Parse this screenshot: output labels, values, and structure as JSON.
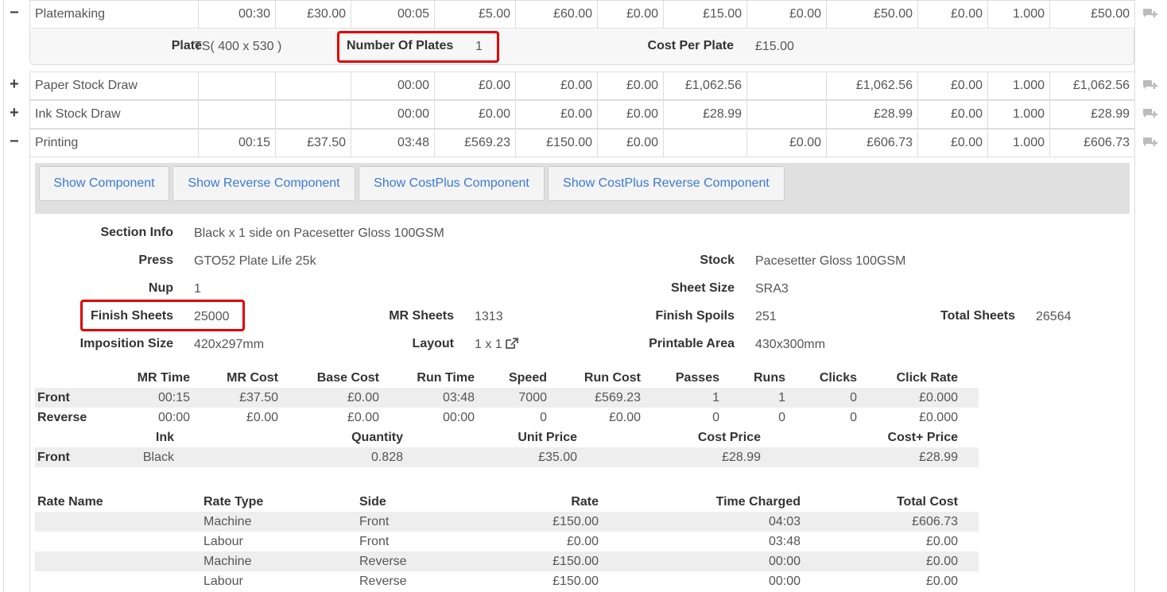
{
  "rows": [
    {
      "name": "Platemaking",
      "toggle": "−",
      "cols": [
        "00:30",
        "£30.00",
        "00:05",
        "£5.00",
        "£60.00",
        "£0.00",
        "£15.00",
        "£0.00",
        "£50.00",
        "£0.00",
        "1.000",
        "£50.00"
      ]
    },
    {
      "name": "Paper Stock Draw",
      "toggle": "+",
      "cols": [
        "",
        "",
        "00:00",
        "£0.00",
        "£0.00",
        "£0.00",
        "£1,062.56",
        "",
        "£1,062.56",
        "£0.00",
        "1.000",
        "£1,062.56"
      ]
    },
    {
      "name": "Ink Stock Draw",
      "toggle": "+",
      "cols": [
        "",
        "",
        "00:00",
        "£0.00",
        "£0.00",
        "£0.00",
        "£28.99",
        "",
        "£28.99",
        "£0.00",
        "1.000",
        "£28.99"
      ]
    },
    {
      "name": "Printing",
      "toggle": "−",
      "cols": [
        "00:15",
        "£37.50",
        "03:48",
        "£569.23",
        "£150.00",
        "£0.00",
        "",
        "£0.00",
        "£606.73",
        "£0.00",
        "1.000",
        "£606.73"
      ]
    }
  ],
  "plate_detail": {
    "plate_label": "Plate",
    "plate_value": "TS( 400 x 530 )",
    "num_plates_label": "Number Of Plates",
    "num_plates_value": "1",
    "cost_per_plate_label": "Cost Per Plate",
    "cost_per_plate_value": "£15.00"
  },
  "buttons": {
    "show_component": "Show Component",
    "show_reverse_component": "Show Reverse Component",
    "show_costplus_component": "Show CostPlus Component",
    "show_costplus_reverse_component": "Show CostPlus Reverse Component"
  },
  "section": {
    "section_info_label": "Section Info",
    "section_info_value": "Black x 1 side on Pacesetter Gloss 100GSM",
    "press_label": "Press",
    "press_value": "GTO52 Plate Life 25k",
    "stock_label": "Stock",
    "stock_value": "Pacesetter Gloss 100GSM",
    "nup_label": "Nup",
    "nup_value": "1",
    "sheet_size_label": "Sheet Size",
    "sheet_size_value": "SRA3",
    "finish_sheets_label": "Finish Sheets",
    "finish_sheets_value": "25000",
    "mr_sheets_label": "MR Sheets",
    "mr_sheets_value": "1313",
    "finish_spoils_label": "Finish Spoils",
    "finish_spoils_value": "251",
    "total_sheets_label": "Total Sheets",
    "total_sheets_value": "26564",
    "imposition_label": "Imposition Size",
    "imposition_value": "420x297mm",
    "layout_label": "Layout",
    "layout_value": "1 x 1",
    "printable_label": "Printable Area",
    "printable_value": "430x300mm"
  },
  "run_table": {
    "headers": [
      "MR Time",
      "MR Cost",
      "Base Cost",
      "Run Time",
      "Speed",
      "Run Cost",
      "Passes",
      "Runs",
      "Clicks",
      "Click Rate"
    ],
    "rows": [
      {
        "side": "Front",
        "values": [
          "00:15",
          "£37.50",
          "£0.00",
          "03:48",
          "7000",
          "£569.23",
          "1",
          "1",
          "0",
          "£0.000"
        ]
      },
      {
        "side": "Reverse",
        "values": [
          "00:00",
          "£0.00",
          "£0.00",
          "00:00",
          "0",
          "£0.00",
          "0",
          "0",
          "0",
          "£0.000"
        ]
      }
    ]
  },
  "ink_table": {
    "headers": [
      "Ink",
      "Quantity",
      "Unit Price",
      "Cost Price",
      "Cost+ Price"
    ],
    "rows": [
      {
        "side": "Front",
        "values": [
          "Black",
          "0.828",
          "£35.00",
          "£28.99",
          "£28.99"
        ]
      }
    ]
  },
  "rate_table": {
    "headers": [
      "Rate Name",
      "Rate Type",
      "Side",
      "Rate",
      "Time Charged",
      "Total Cost"
    ],
    "rows": [
      [
        "",
        "Machine",
        "Front",
        "£150.00",
        "04:03",
        "£606.73"
      ],
      [
        "",
        "Labour",
        "Front",
        "£0.00",
        "03:48",
        "£0.00"
      ],
      [
        "",
        "Machine",
        "Reverse",
        "£150.00",
        "00:00",
        "£0.00"
      ],
      [
        "",
        "Labour",
        "Reverse",
        "£150.00",
        "00:00",
        "£0.00"
      ]
    ]
  },
  "colors": {
    "highlight": "#e00000",
    "link": "#3a7bd5"
  }
}
